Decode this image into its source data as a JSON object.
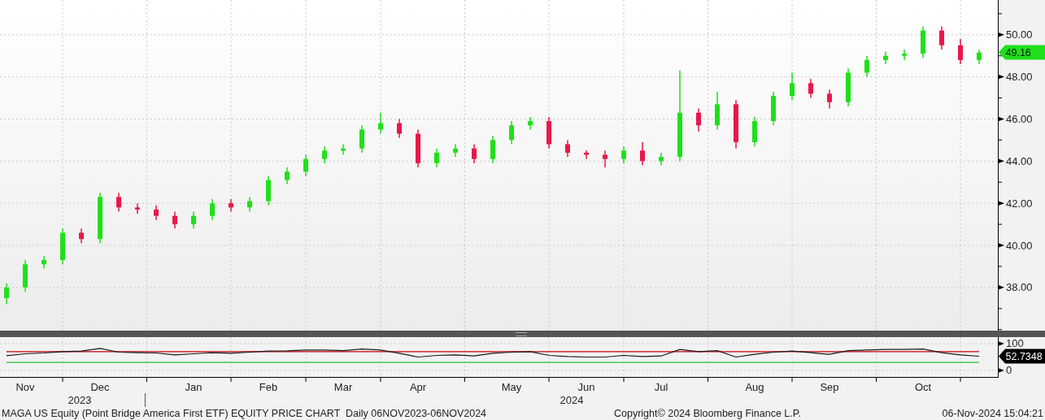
{
  "price_chart": {
    "last_price": "49.16",
    "chart_data": {
      "type": "candlestick",
      "categories": [
        null,
        null,
        null,
        null,
        null,
        null,
        null,
        null,
        null,
        null,
        null,
        null,
        null,
        null,
        null,
        null,
        null,
        null,
        null,
        null,
        null,
        null,
        null,
        null,
        null,
        null,
        null,
        null,
        null,
        null,
        null,
        null,
        null,
        null,
        null,
        null,
        null,
        null,
        null,
        null,
        null,
        null,
        null,
        null,
        null,
        null,
        null,
        null,
        null,
        null,
        null,
        null,
        null
      ],
      "ohlc": [
        [
          37.5,
          38.2,
          37.2,
          38.0
        ],
        [
          38.0,
          39.3,
          37.8,
          39.1
        ],
        [
          39.1,
          39.5,
          38.9,
          39.3
        ],
        [
          39.3,
          40.8,
          39.1,
          40.6
        ],
        [
          40.6,
          40.8,
          40.1,
          40.3
        ],
        [
          40.3,
          42.5,
          40.1,
          42.3
        ],
        [
          42.3,
          42.5,
          41.6,
          41.8
        ],
        [
          41.8,
          42.0,
          41.5,
          41.7
        ],
        [
          41.7,
          41.9,
          41.2,
          41.4
        ],
        [
          41.4,
          41.6,
          40.8,
          41.0
        ],
        [
          41.0,
          41.6,
          40.8,
          41.4
        ],
        [
          41.4,
          42.2,
          41.2,
          42.0
        ],
        [
          42.0,
          42.2,
          41.6,
          41.8
        ],
        [
          41.8,
          42.3,
          41.6,
          42.1
        ],
        [
          42.1,
          43.3,
          41.9,
          43.1
        ],
        [
          43.1,
          43.7,
          42.9,
          43.5
        ],
        [
          43.5,
          44.3,
          43.3,
          44.1
        ],
        [
          44.1,
          44.7,
          43.9,
          44.5
        ],
        [
          44.5,
          44.8,
          44.3,
          44.6
        ],
        [
          44.6,
          45.7,
          44.4,
          45.5
        ],
        [
          45.5,
          46.3,
          45.3,
          45.8
        ],
        [
          45.8,
          46.0,
          45.1,
          45.3
        ],
        [
          45.3,
          45.5,
          43.7,
          43.9
        ],
        [
          43.9,
          44.6,
          43.7,
          44.4
        ],
        [
          44.4,
          44.8,
          44.2,
          44.6
        ],
        [
          44.6,
          44.8,
          43.9,
          44.1
        ],
        [
          44.1,
          45.2,
          43.9,
          45.0
        ],
        [
          45.0,
          45.9,
          44.8,
          45.7
        ],
        [
          45.7,
          46.1,
          45.5,
          45.9
        ],
        [
          45.9,
          46.1,
          44.6,
          44.8
        ],
        [
          44.8,
          45.0,
          44.2,
          44.4
        ],
        [
          44.4,
          44.5,
          44.1,
          44.3
        ],
        [
          44.3,
          44.5,
          43.7,
          44.1
        ],
        [
          44.1,
          44.7,
          43.9,
          44.5
        ],
        [
          44.5,
          44.9,
          43.8,
          44.0
        ],
        [
          44.0,
          44.4,
          43.8,
          44.2
        ],
        [
          44.2,
          48.3,
          44.0,
          46.3
        ],
        [
          46.3,
          46.5,
          45.4,
          45.7
        ],
        [
          45.7,
          47.3,
          45.5,
          46.7
        ],
        [
          46.7,
          46.9,
          44.6,
          44.9
        ],
        [
          44.9,
          46.1,
          44.7,
          45.9
        ],
        [
          45.9,
          47.3,
          45.7,
          47.1
        ],
        [
          47.1,
          48.2,
          46.9,
          47.7
        ],
        [
          47.7,
          47.9,
          47.0,
          47.2
        ],
        [
          47.2,
          47.4,
          46.5,
          46.8
        ],
        [
          46.8,
          48.4,
          46.6,
          48.2
        ],
        [
          48.2,
          49.0,
          48.0,
          48.8
        ],
        [
          48.8,
          49.2,
          48.6,
          49.0
        ],
        [
          49.0,
          49.3,
          48.8,
          49.1
        ],
        [
          49.1,
          50.4,
          48.9,
          50.2
        ],
        [
          50.2,
          50.4,
          49.3,
          49.5
        ],
        [
          49.5,
          49.8,
          48.6,
          48.8
        ],
        [
          48.8,
          49.3,
          48.6,
          49.16
        ]
      ],
      "ylim": [
        35.95,
        51.65
      ],
      "grid": true,
      "yticks": [
        {
          "value": 38,
          "label": "38.00"
        },
        {
          "value": 40,
          "label": "40.00"
        },
        {
          "value": 42,
          "label": "42.00"
        },
        {
          "value": 44,
          "label": "44.00"
        },
        {
          "value": 46,
          "label": "46.00"
        },
        {
          "value": 48,
          "label": "48.00"
        },
        {
          "value": 50,
          "label": "50.00"
        }
      ]
    }
  },
  "rsi_panel": {
    "last_value": "52.7348",
    "chart_data": {
      "type": "line",
      "categories": [
        null,
        "Nov",
        null,
        null,
        null,
        "Dec",
        null,
        null,
        null,
        null,
        "Jan",
        null,
        null,
        null,
        "Feb",
        null,
        null,
        null,
        "Mar",
        null,
        null,
        null,
        "Apr",
        null,
        null,
        null,
        null,
        "May",
        null,
        null,
        null,
        "Jun",
        null,
        null,
        null,
        "Jul",
        null,
        null,
        null,
        null,
        "Aug",
        null,
        null,
        null,
        "Sep",
        null,
        null,
        null,
        null,
        "Oct",
        null,
        null,
        null
      ],
      "series": [
        {
          "color": "#c00000",
          "values": [
            70,
            70,
            70,
            70,
            70,
            70,
            70,
            70,
            70,
            70,
            70,
            70,
            70,
            70,
            70,
            70,
            70,
            70,
            70,
            70,
            70,
            70,
            70,
            70,
            70,
            70,
            70,
            70,
            70,
            70,
            70,
            70,
            70,
            70,
            70,
            70,
            70,
            70,
            70,
            70,
            70,
            70,
            70,
            70,
            70,
            70,
            70,
            70,
            70,
            70,
            70,
            70,
            70
          ]
        },
        {
          "color": "#22c02a",
          "values": [
            30,
            30,
            30,
            30,
            30,
            30,
            30,
            30,
            30,
            30,
            30,
            30,
            30,
            30,
            30,
            30,
            30,
            30,
            30,
            30,
            30,
            30,
            30,
            30,
            30,
            30,
            30,
            30,
            30,
            30,
            30,
            30,
            30,
            30,
            30,
            30,
            30,
            30,
            30,
            30,
            30,
            30,
            30,
            30,
            30,
            30,
            30,
            30,
            30,
            30,
            30,
            30,
            30
          ]
        },
        {
          "color": "#1a1a1a",
          "values": [
            55,
            62,
            65,
            70,
            72,
            82,
            68,
            66,
            65,
            58,
            62,
            66,
            64,
            68,
            72,
            73,
            76,
            76,
            74,
            80,
            76,
            64,
            50,
            56,
            58,
            54,
            64,
            68,
            70,
            56,
            52,
            50,
            50,
            56,
            52,
            54,
            78,
            70,
            74,
            50,
            60,
            68,
            72,
            66,
            60,
            74,
            76,
            78,
            78,
            80,
            66,
            58,
            53
          ]
        }
      ],
      "ylim": [
        -27.3,
        124.2
      ],
      "grid": true,
      "yticks": [
        0,
        100
      ]
    }
  },
  "time_axis": {
    "years": [
      "2023",
      "2024"
    ]
  },
  "footer": {
    "title": "MAGA US Equity (Point Bridge America First ETF) EQUITY PRICE CHART  Daily 06NOV2023-06NOV2024",
    "copyright": "Copyright© 2024 Bloomberg Finance L.P.",
    "timestamp": "06-Nov-2024 15:04:21"
  }
}
